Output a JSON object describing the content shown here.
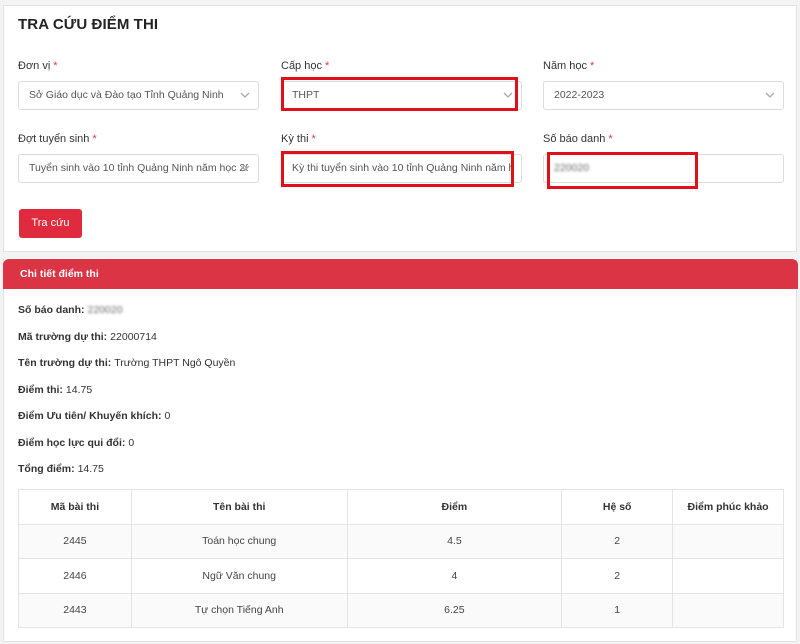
{
  "search": {
    "title": "TRA CỨU ĐIỂM THI",
    "fields": {
      "don_vi": {
        "label": "Đơn vị",
        "required": "*",
        "value": "Sở Giáo dục và Đào tạo Tỉnh Quảng Ninh"
      },
      "cap_hoc": {
        "label": "Cấp học",
        "required": "*",
        "value": "THPT"
      },
      "nam_hoc": {
        "label": "Năm học",
        "required": "*",
        "value": "2022-2023"
      },
      "dot_tuyen_sinh": {
        "label": "Đợt tuyển sinh",
        "required": "*",
        "value": "Tuyển sinh vào 10 tỉnh Quảng Ninh năm học 20"
      },
      "ky_thi": {
        "label": "Kỳ thi",
        "required": "*",
        "value": "Kỳ thi tuyển sinh vào 10 tỉnh Quảng Ninh năm h"
      },
      "so_bao_danh": {
        "label": "Số báo danh",
        "required": "*",
        "value": "220020"
      }
    },
    "submit_label": "Tra cứu"
  },
  "detail": {
    "header": "Chi tiết điểm thi",
    "lines": [
      {
        "key": "Số báo danh:",
        "value": "220020"
      },
      {
        "key": "Mã trường dự thi:",
        "value": "22000714"
      },
      {
        "key": "Tên trường dự thi:",
        "value": "Trường THPT Ngô Quyền"
      },
      {
        "key": "Điểm thi:",
        "value": "14.75"
      },
      {
        "key": "Điểm Ưu tiên/ Khuyến khích:",
        "value": "0"
      },
      {
        "key": "Điểm học lực qui đổi:",
        "value": "0"
      },
      {
        "key": "Tổng điểm:",
        "value": "14.75"
      }
    ],
    "table": {
      "headers": [
        "Mã bài thi",
        "Tên bài thi",
        "Điểm",
        "Hệ số",
        "Điểm phúc khảo"
      ],
      "rows": [
        [
          "2445",
          "Toán học chung",
          "4.5",
          "2",
          ""
        ],
        [
          "2446",
          "Ngữ Văn chung",
          "4",
          "2",
          ""
        ],
        [
          "2443",
          "Tự chọn Tiếng Anh",
          "6.25",
          "1",
          ""
        ]
      ]
    }
  },
  "colors": {
    "accent": "#db3545",
    "button": "#e02a3d",
    "highlight_box": "#e0101a",
    "required": "#e03a3a"
  },
  "icons": {
    "select_arrow": "chevron-down-icon"
  }
}
